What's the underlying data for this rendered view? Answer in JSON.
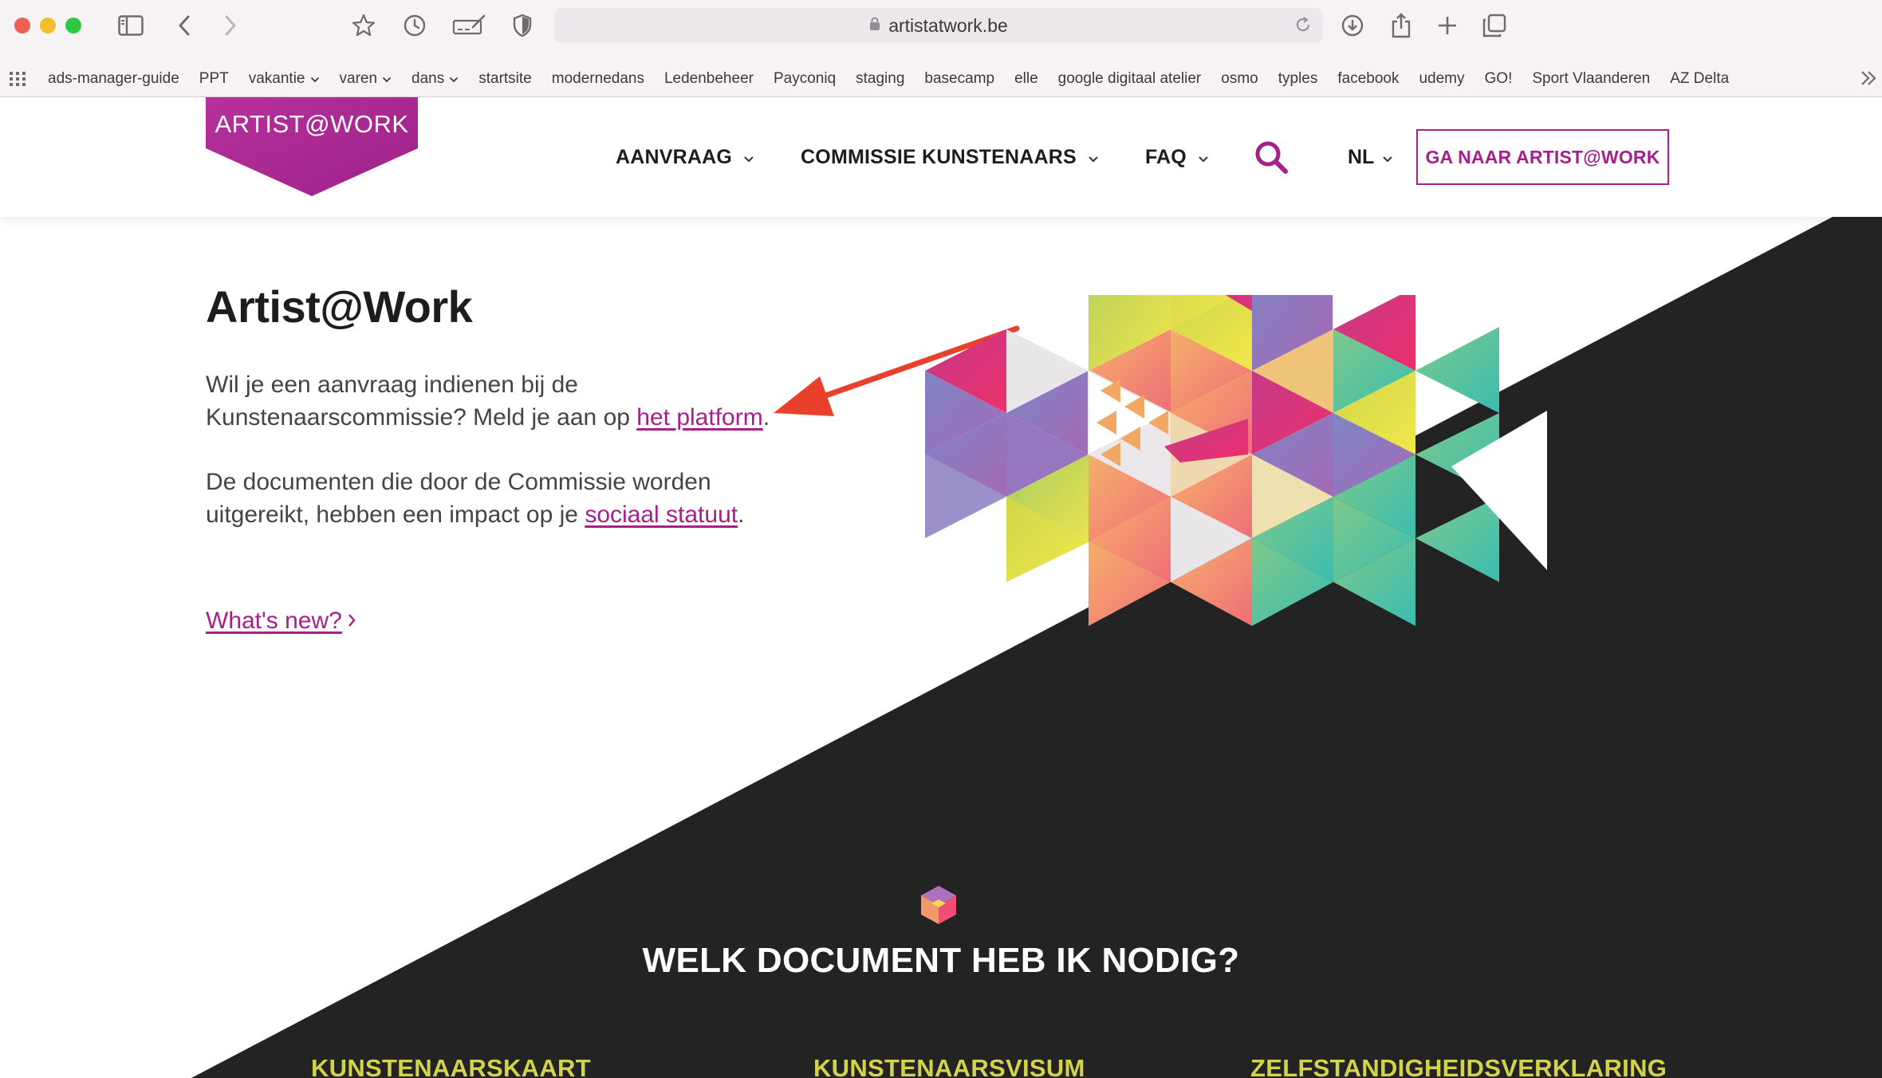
{
  "browser": {
    "url": "artistatwork.be",
    "bookmarks": [
      {
        "label": "ads-manager-guide",
        "dropdown": false
      },
      {
        "label": "PPT",
        "dropdown": false
      },
      {
        "label": "vakantie",
        "dropdown": true
      },
      {
        "label": "varen",
        "dropdown": true
      },
      {
        "label": "dans",
        "dropdown": true
      },
      {
        "label": "startsite",
        "dropdown": false
      },
      {
        "label": "modernedans",
        "dropdown": false
      },
      {
        "label": "Ledenbeheer",
        "dropdown": false
      },
      {
        "label": "Payconiq",
        "dropdown": false
      },
      {
        "label": "staging",
        "dropdown": false
      },
      {
        "label": "basecamp",
        "dropdown": false
      },
      {
        "label": "elle",
        "dropdown": false
      },
      {
        "label": "google digitaal atelier",
        "dropdown": false
      },
      {
        "label": "osmo",
        "dropdown": false
      },
      {
        "label": "typles",
        "dropdown": false
      },
      {
        "label": "facebook",
        "dropdown": false
      },
      {
        "label": "udemy",
        "dropdown": false
      },
      {
        "label": "GO!",
        "dropdown": false
      },
      {
        "label": "Sport Vlaanderen",
        "dropdown": false
      },
      {
        "label": "AZ Delta",
        "dropdown": false
      }
    ]
  },
  "header": {
    "logo_text": "ARTIST@WORK",
    "nav": [
      {
        "label": "AANVRAAG"
      },
      {
        "label": "COMMISSIE KUNSTENAARS"
      },
      {
        "label": "FAQ"
      }
    ],
    "language": "NL",
    "cta_label": "GA NAAR ARTIST@WORK"
  },
  "hero": {
    "title": "Artist@Work",
    "p1_before": "Wil je een aanvraag indienen bij de Kunstenaarscommissie? Meld je aan op ",
    "p1_link": "het platform",
    "p1_after": ".",
    "p2_before": "De documenten die door de Commissie worden uitgereikt, hebben een impact op je ",
    "p2_link": "sociaal statuut",
    "p2_after": ".",
    "whats_new": "What's new?"
  },
  "section": {
    "title": "WELK DOCUMENT HEB IK NODIG?",
    "documents": [
      "KUNSTENAARSKAART",
      "KUNSTENAARSVISUM",
      "ZELFSTANDIGHEIDSVERKLARING"
    ]
  },
  "colors": {
    "brand": "#a71f8a",
    "dark_bg": "#222222",
    "doc_link": "#d3d34a",
    "annotation_arrow": "#e8402a"
  },
  "icons": {
    "search": "search-icon",
    "cube": "cube-icon"
  }
}
